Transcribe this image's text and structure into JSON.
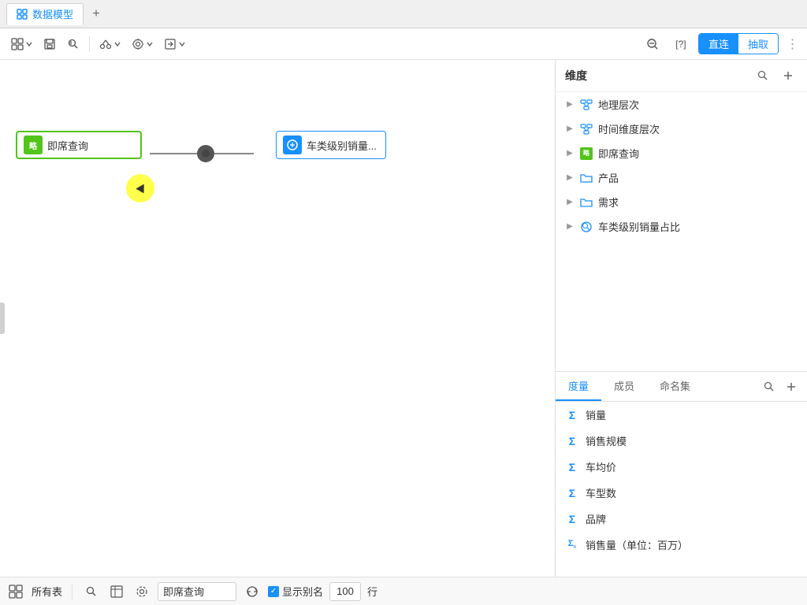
{
  "tabs": [
    {
      "id": "data-model",
      "label": "数据模型",
      "active": true
    }
  ],
  "add_tab_label": "+",
  "toolbar": {
    "buttons": [
      {
        "id": "layout",
        "label": "",
        "icon": "layout-icon"
      },
      {
        "id": "save",
        "label": "",
        "icon": "save-icon"
      },
      {
        "id": "search",
        "label": "",
        "icon": "search-icon"
      },
      {
        "id": "cut",
        "label": "",
        "icon": "cut-icon"
      },
      {
        "id": "settings",
        "label": "",
        "icon": "settings-icon"
      },
      {
        "id": "import",
        "label": "",
        "icon": "import-icon"
      }
    ],
    "zoom_out": "⊖",
    "help": "[?]",
    "mode_direct": "直连",
    "mode_extract": "抽取",
    "dots": "⋮"
  },
  "canvas": {
    "node_left": {
      "icon_text": "略",
      "label": "即席查询"
    },
    "node_right": {
      "icon": "S",
      "label": "车类级别销量..."
    }
  },
  "right_panel": {
    "dimensions_title": "维度",
    "tree_items": [
      {
        "id": "geo",
        "icon": "geo-icon",
        "label": "地理层次",
        "type": "hierarchy"
      },
      {
        "id": "time",
        "icon": "time-icon",
        "label": "时间维度层次",
        "type": "hierarchy"
      },
      {
        "id": "adhoc",
        "icon": "adhoc-icon",
        "label": "即席查询",
        "type": "adhoc"
      },
      {
        "id": "product",
        "icon": "folder-icon",
        "label": "产品",
        "type": "folder"
      },
      {
        "id": "demand",
        "icon": "folder-icon",
        "label": "需求",
        "type": "folder"
      },
      {
        "id": "car-sales",
        "icon": "search-circle-icon",
        "label": "车类级别销量占比",
        "type": "search"
      }
    ],
    "bottom_tabs": [
      {
        "id": "measure",
        "label": "度量",
        "active": true
      },
      {
        "id": "member",
        "label": "成员",
        "active": false
      },
      {
        "id": "naming",
        "label": "命名集",
        "active": false
      }
    ],
    "measures": [
      {
        "id": "sales-vol",
        "label": "销量",
        "icon": "sigma"
      },
      {
        "id": "sales-scale",
        "label": "销售规模",
        "icon": "sigma"
      },
      {
        "id": "car-avg-price",
        "label": "车均价",
        "icon": "sigma"
      },
      {
        "id": "car-type-count",
        "label": "车型数",
        "icon": "sigma"
      },
      {
        "id": "brand",
        "label": "品牌",
        "icon": "sigma"
      },
      {
        "id": "sales-million",
        "label": "销售量（单位：百万）",
        "icon": "sigma-special"
      }
    ]
  },
  "status_bar": {
    "all_tables_label": "所有表",
    "query_label": "即席查询",
    "display_alias_label": "显示别名",
    "row_label": "行",
    "count_value": "100"
  }
}
